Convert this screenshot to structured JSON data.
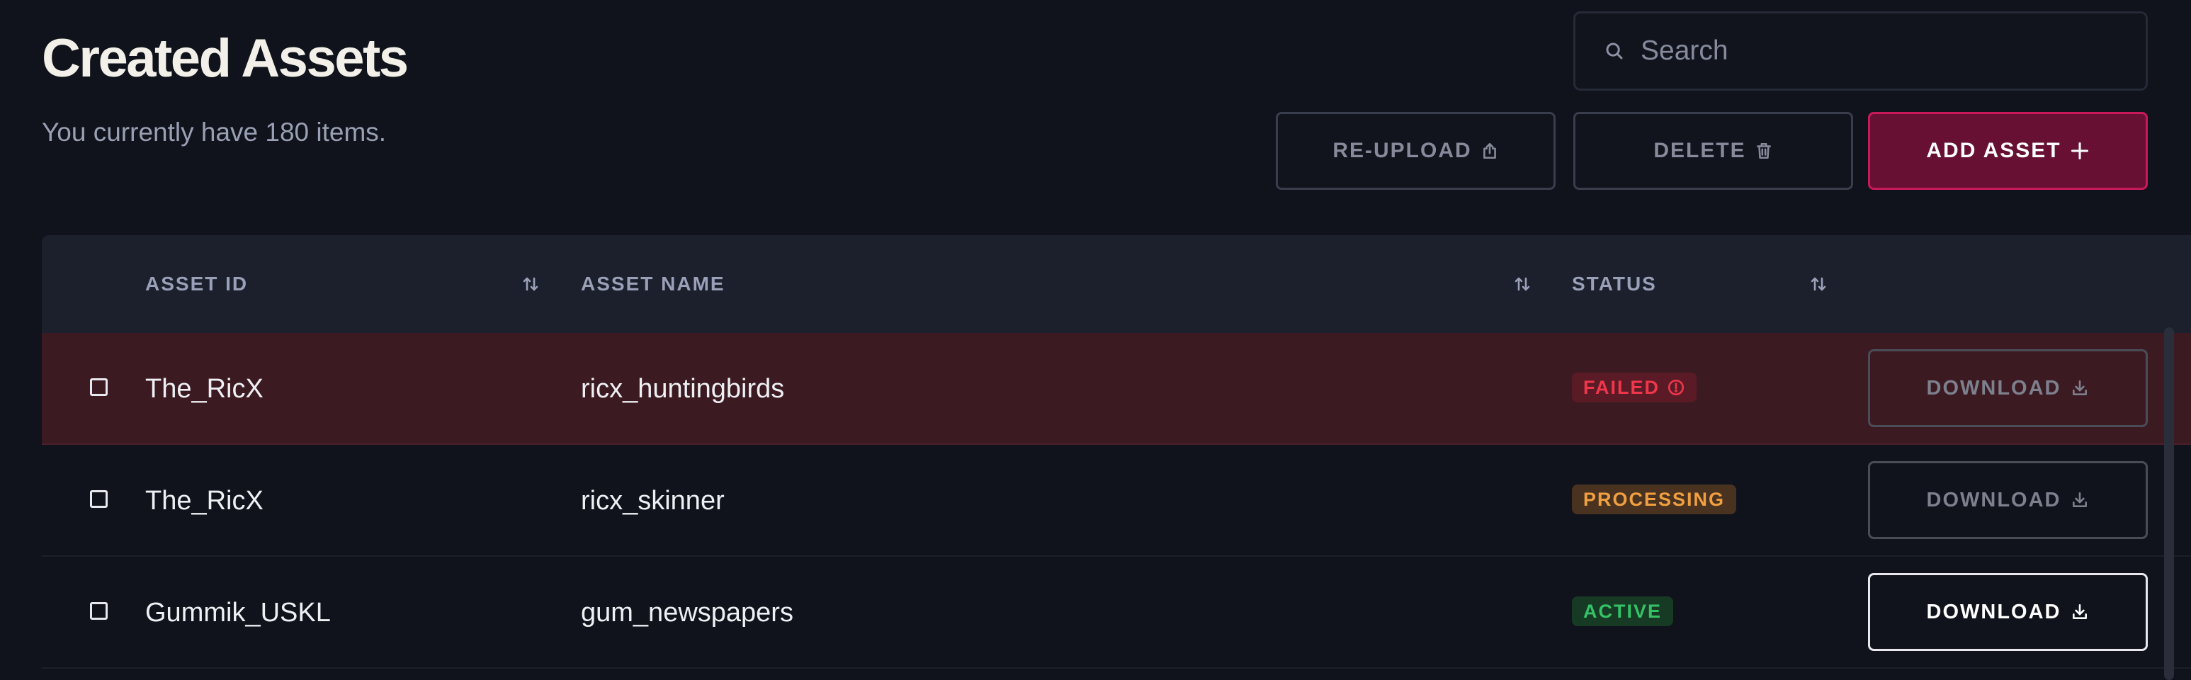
{
  "header": {
    "title": "Created Assets",
    "subtitle": "You currently have 180 items."
  },
  "search": {
    "placeholder": "Search",
    "value": "",
    "icon": "search-icon"
  },
  "toolbar": {
    "reupload_label": "RE-UPLOAD",
    "delete_label": "DELETE",
    "add_label": "ADD ASSET",
    "icons": {
      "reupload": "upload-icon",
      "delete": "trash-icon",
      "add": "plus-icon"
    }
  },
  "table": {
    "columns": [
      {
        "label": "ASSET ID",
        "sortable": true
      },
      {
        "label": "ASSET NAME",
        "sortable": true
      },
      {
        "label": "STATUS",
        "sortable": true
      }
    ],
    "rows": [
      {
        "asset_id": "The_RicX",
        "asset_name": "ricx_huntingbirds",
        "status": "FAILED",
        "status_icon": "alert-circle-icon",
        "download_label": "DOWNLOAD",
        "download_enabled": false
      },
      {
        "asset_id": "The_RicX",
        "asset_name": "ricx_skinner",
        "status": "PROCESSING",
        "download_label": "DOWNLOAD",
        "download_enabled": false
      },
      {
        "asset_id": "Gummik_USKL",
        "asset_name": "gum_newspapers",
        "status": "ACTIVE",
        "download_label": "DOWNLOAD",
        "download_enabled": true
      }
    ]
  },
  "colors": {
    "background": "#10131b",
    "table_header": "#1c202c",
    "accent": "#c8195a",
    "accent_fill": "#681034",
    "failed_row": "#3c1a22",
    "status_failed": "#f0364a",
    "status_processing": "#f0a040",
    "status_active": "#35c267"
  }
}
